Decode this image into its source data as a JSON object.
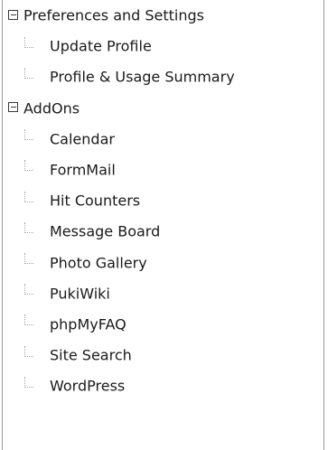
{
  "tree": {
    "groups": [
      {
        "label": "Preferences and Settings",
        "expanded": true,
        "items": [
          {
            "label": "Update Profile"
          },
          {
            "label": "Profile & Usage Summary"
          }
        ]
      },
      {
        "label": "AddOns",
        "expanded": true,
        "items": [
          {
            "label": "Calendar"
          },
          {
            "label": "FormMail"
          },
          {
            "label": "Hit Counters"
          },
          {
            "label": "Message Board"
          },
          {
            "label": "Photo Gallery"
          },
          {
            "label": "PukiWiki"
          },
          {
            "label": "phpMyFAQ"
          },
          {
            "label": "Site Search"
          },
          {
            "label": "WordPress"
          }
        ]
      }
    ],
    "icons": {
      "toggle": "collapse-minus-icon",
      "connector": "tree-branch-icon"
    },
    "colors": {
      "text": "#1a1a1a",
      "border": "#9a9a9a",
      "connector": "#a8a8a8",
      "background": "#ffffff"
    }
  }
}
